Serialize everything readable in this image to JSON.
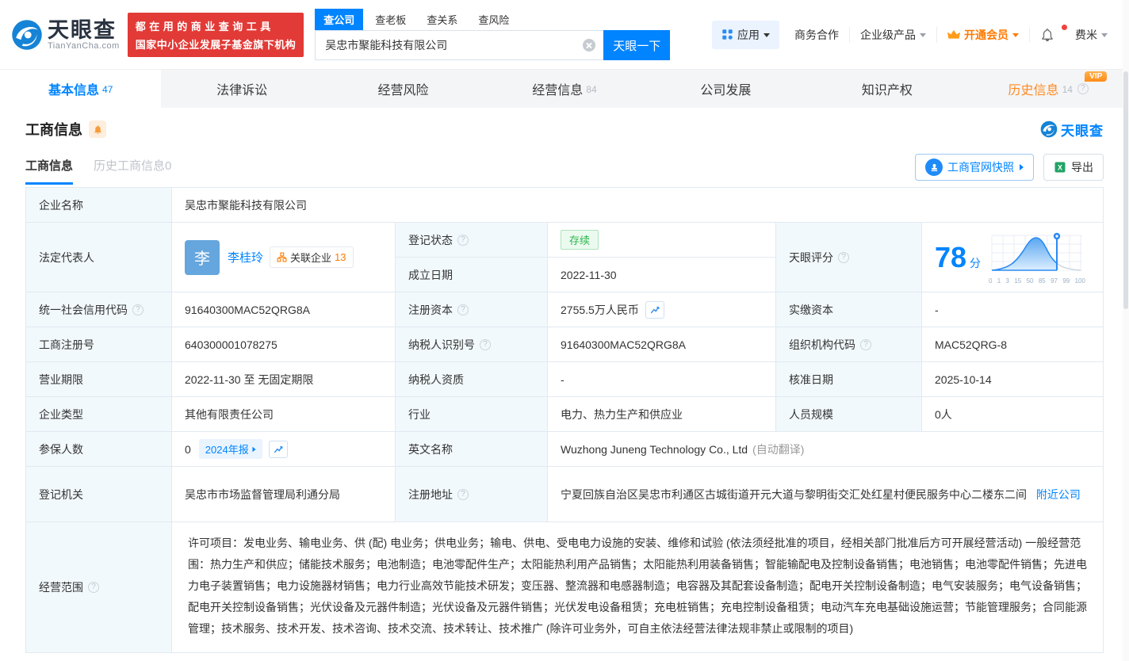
{
  "header": {
    "logo": {
      "title": "天眼查",
      "subtitle": "TianYanCha.com"
    },
    "promo": {
      "line1": "都在用的商业查询工具",
      "line2": "国家中小企业发展子基金旗下机构"
    },
    "search": {
      "tabs": [
        {
          "label": "查公司"
        },
        {
          "label": "查老板"
        },
        {
          "label": "查关系"
        },
        {
          "label": "查风险"
        }
      ],
      "value": "吴忠市聚能科技有限公司",
      "button": "天眼一下"
    },
    "nav": {
      "apps": "应用",
      "cooperation": "商务合作",
      "enterprise": "企业级产品",
      "vip": "开通会员",
      "user": "费米"
    }
  },
  "tabs": [
    {
      "label": "基本信息",
      "count": "47"
    },
    {
      "label": "法律诉讼",
      "count": ""
    },
    {
      "label": "经营风险",
      "count": ""
    },
    {
      "label": "经营信息",
      "count": "84"
    },
    {
      "label": "公司发展",
      "count": ""
    },
    {
      "label": "知识产权",
      "count": ""
    },
    {
      "label": "历史信息",
      "count": "14",
      "badge": "VIP"
    }
  ],
  "section": {
    "title": "工商信息",
    "brand": "天眼查"
  },
  "subtabs": {
    "current": "工商信息",
    "history": "历史工商信息0"
  },
  "actions": {
    "snapshot": "工商官网快照",
    "export": "导出"
  },
  "score": {
    "label": "天眼评分",
    "value": "78",
    "unit": "分",
    "axis": [
      "0",
      "1",
      "3",
      "15",
      "50",
      "85",
      "97",
      "99",
      "100"
    ]
  },
  "table": {
    "company_name_label": "企业名称",
    "company_name": "吴忠市聚能科技有限公司",
    "legal_rep_label": "法定代表人",
    "legal_rep_avatar": "李",
    "legal_rep_name": "李桂玲",
    "related_label": "关联企业",
    "related_count": "13",
    "reg_status_label": "登记状态",
    "reg_status": "存续",
    "est_date_label": "成立日期",
    "est_date": "2022-11-30",
    "uscc_label": "统一社会信用代码",
    "uscc": "91640300MAC52QRG8A",
    "reg_capital_label": "注册资本",
    "reg_capital": "2755.5万人民币",
    "paid_capital_label": "实缴资本",
    "paid_capital": "-",
    "reg_no_label": "工商注册号",
    "reg_no": "640300001078275",
    "taxpayer_id_label": "纳税人识别号",
    "taxpayer_id": "91640300MAC52QRG8A",
    "org_code_label": "组织机构代码",
    "org_code": "MAC52QRG-8",
    "business_term_label": "营业期限",
    "business_term": "2022-11-30 至 无固定期限",
    "taxpayer_quality_label": "纳税人资质",
    "taxpayer_quality": "-",
    "approval_date_label": "核准日期",
    "approval_date": "2025-10-14",
    "company_type_label": "企业类型",
    "company_type": "其他有限责任公司",
    "industry_label": "行业",
    "industry": "电力、热力生产和供应业",
    "staff_size_label": "人员规模",
    "staff_size": "0人",
    "insured_label": "参保人数",
    "insured_count": "0",
    "annual_report_badge": "2024年报",
    "english_name_label": "英文名称",
    "english_name": "Wuzhong Juneng Technology Co., Ltd",
    "english_name_note": "(自动翻译)",
    "reg_authority_label": "登记机关",
    "reg_authority": "吴忠市市场监督管理局利通分局",
    "reg_address_label": "注册地址",
    "reg_address": "宁夏回族自治区吴忠市利通区古城街道开元大道与黎明街交汇处红星村便民服务中心二楼东二间",
    "nearby_link": "附近公司",
    "business_scope_label": "经营范围",
    "business_scope": "许可项目：发电业务、输电业务、供 (配) 电业务；供电业务；输电、供电、受电电力设施的安装、维修和试验 (依法须经批准的项目，经相关部门批准后方可开展经营活动) 一般经营范围：热力生产和供应；储能技术服务；电池制造；电池零配件生产；太阳能热利用产品销售；太阳能热利用装备销售；智能输配电及控制设备销售；电池销售；电池零配件销售；先进电力电子装置销售；电力设施器材销售；电力行业高效节能技术研发；变压器、整流器和电感器制造；电容器及其配套设备制造；配电开关控制设备制造；电气安装服务；电气设备销售；配电开关控制设备销售；光伏设备及元器件制造；光伏设备及元器件销售；光伏发电设备租赁；充电桩销售；充电控制设备租赁；电动汽车充电基础设施运营；节能管理服务；合同能源管理；技术服务、技术开发、技术咨询、技术交流、技术转让、技术推广 (除许可业务外，可自主依法经营法律法规非禁止或限制的项目)"
  }
}
